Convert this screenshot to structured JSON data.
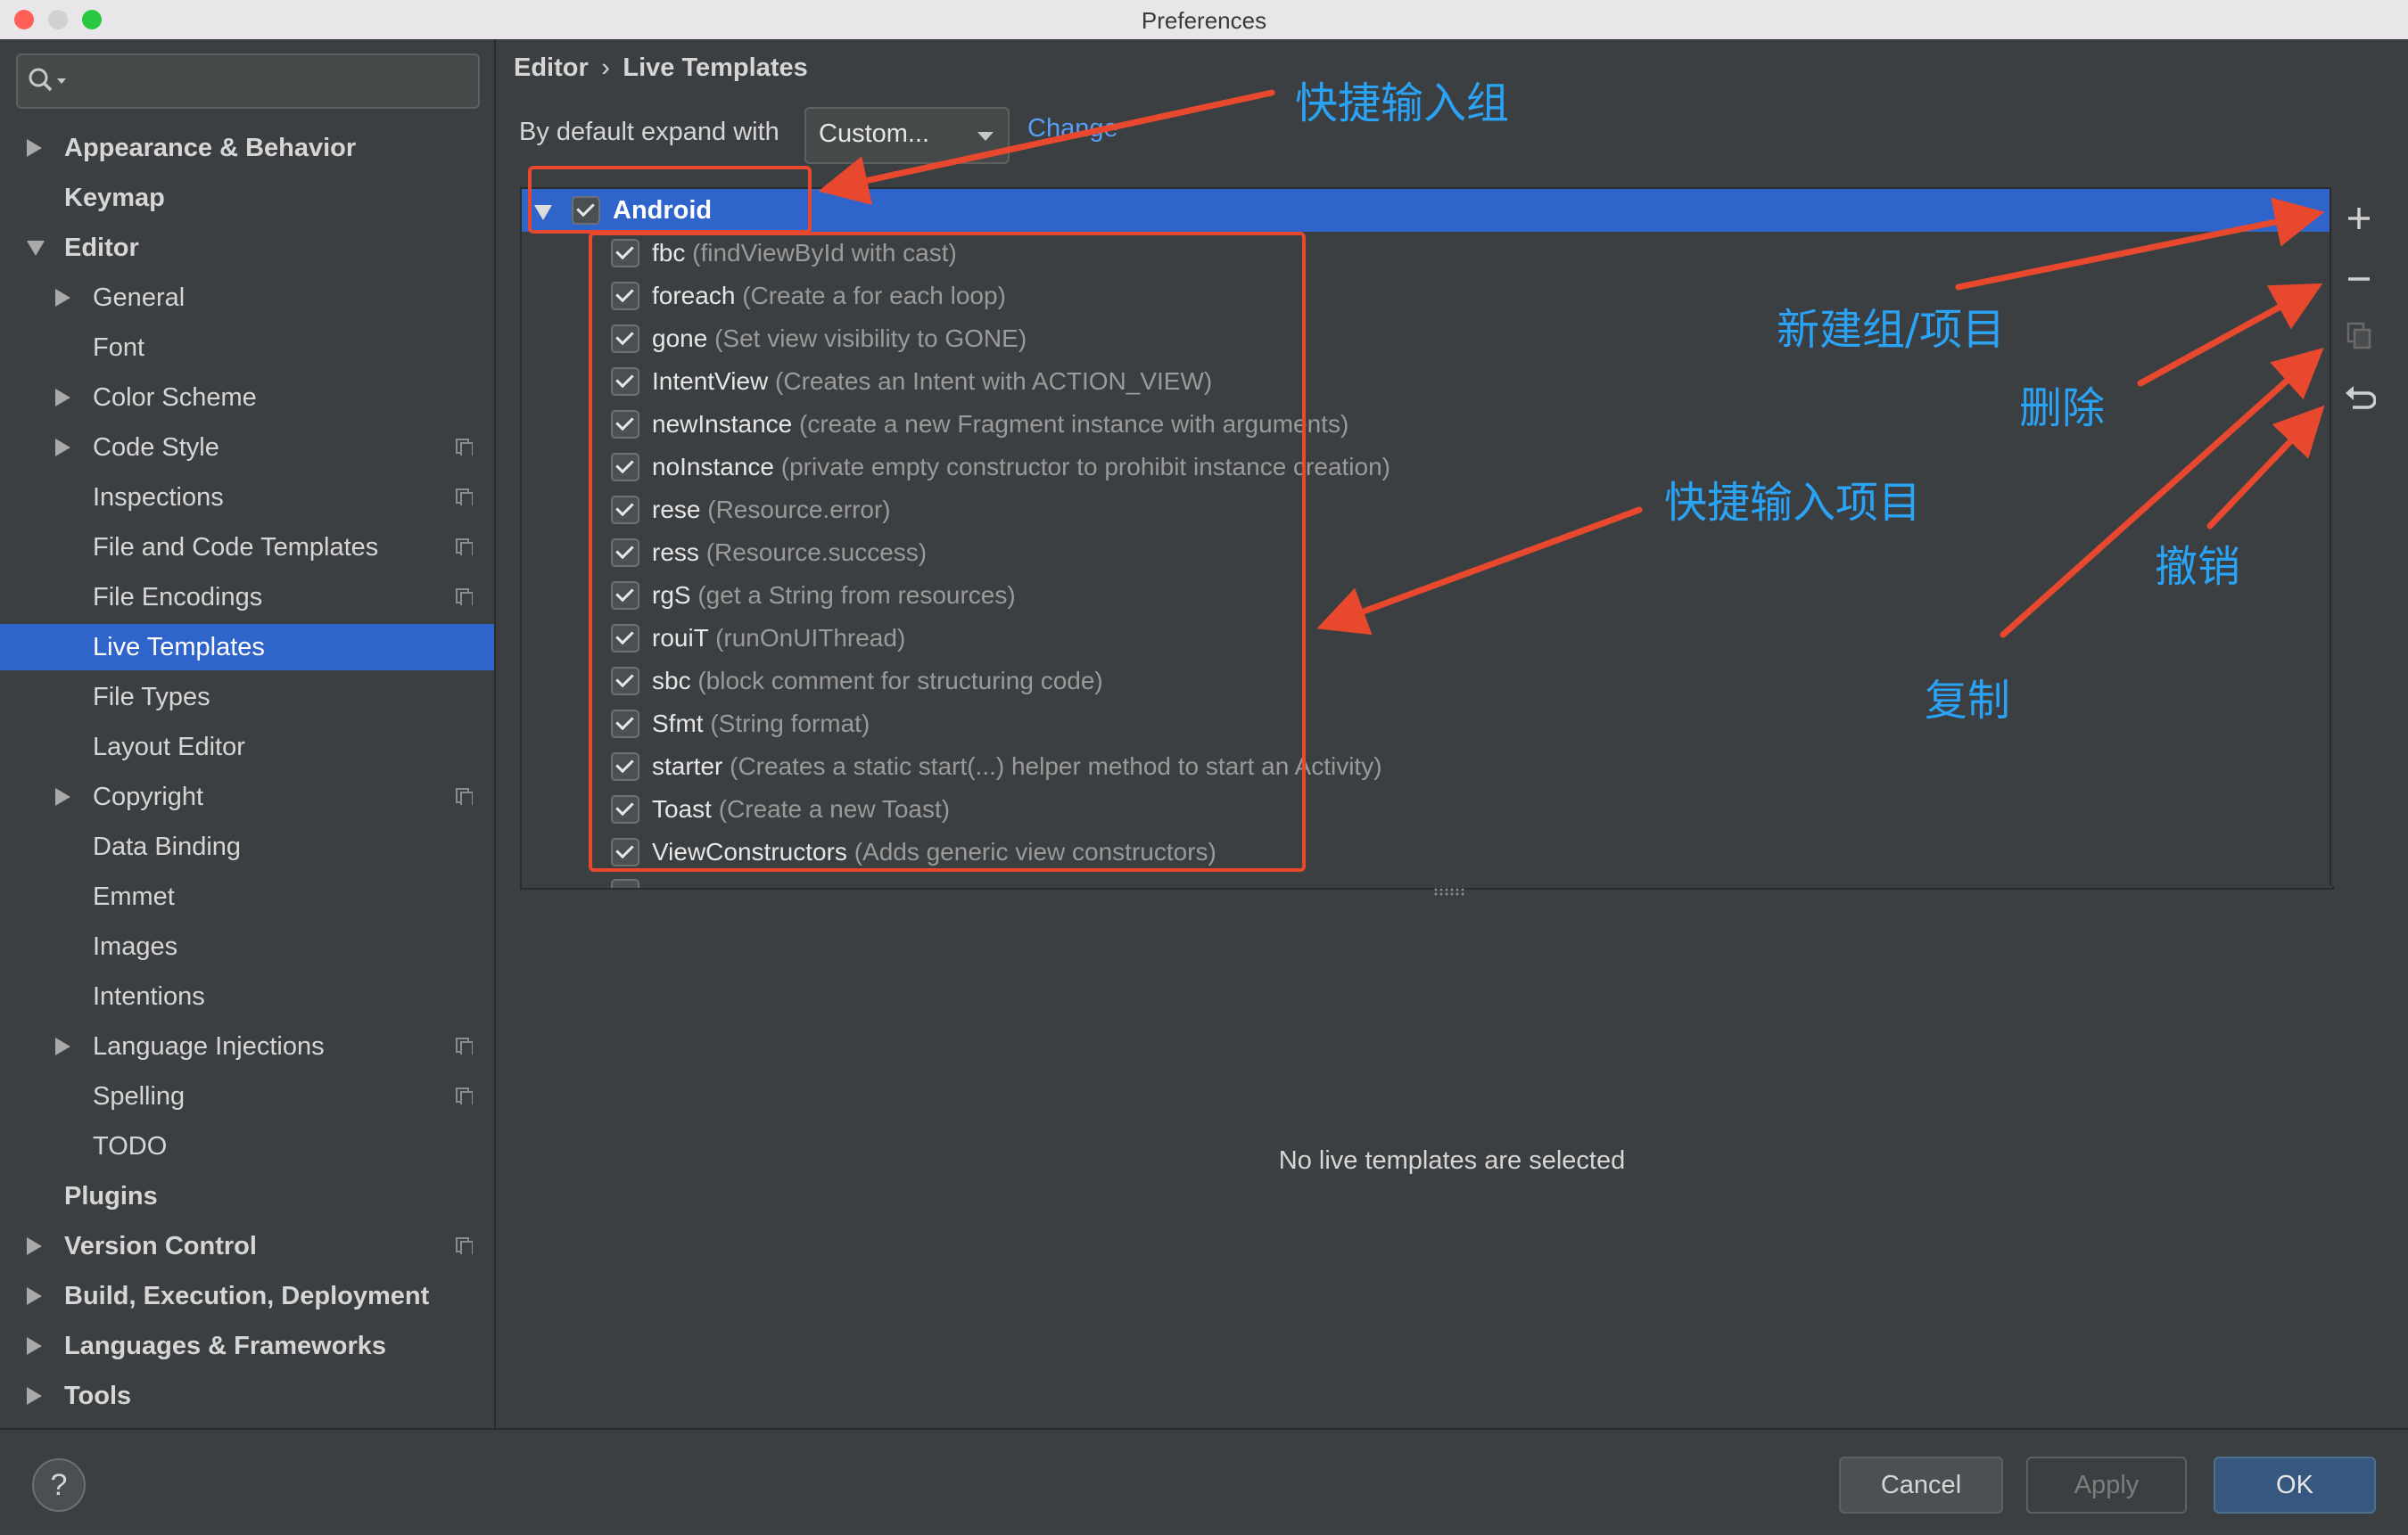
{
  "window": {
    "title": "Preferences"
  },
  "search": {
    "placeholder": ""
  },
  "tree": [
    {
      "label": "Appearance & Behavior",
      "bold": true,
      "level": 0,
      "arrow": "right",
      "icon": false
    },
    {
      "label": "Keymap",
      "bold": true,
      "level": 0,
      "arrow": "none",
      "icon": false
    },
    {
      "label": "Editor",
      "bold": true,
      "level": 0,
      "arrow": "down",
      "icon": false
    },
    {
      "label": "General",
      "bold": false,
      "level": 1,
      "arrow": "right",
      "icon": false
    },
    {
      "label": "Font",
      "bold": false,
      "level": 1,
      "arrow": "none",
      "icon": false
    },
    {
      "label": "Color Scheme",
      "bold": false,
      "level": 1,
      "arrow": "right",
      "icon": false
    },
    {
      "label": "Code Style",
      "bold": false,
      "level": 1,
      "arrow": "right",
      "icon": true
    },
    {
      "label": "Inspections",
      "bold": false,
      "level": 1,
      "arrow": "none",
      "icon": true
    },
    {
      "label": "File and Code Templates",
      "bold": false,
      "level": 1,
      "arrow": "none",
      "icon": true
    },
    {
      "label": "File Encodings",
      "bold": false,
      "level": 1,
      "arrow": "none",
      "icon": true
    },
    {
      "label": "Live Templates",
      "bold": false,
      "level": 1,
      "arrow": "none",
      "icon": false,
      "selected": true
    },
    {
      "label": "File Types",
      "bold": false,
      "level": 1,
      "arrow": "none",
      "icon": false
    },
    {
      "label": "Layout Editor",
      "bold": false,
      "level": 1,
      "arrow": "none",
      "icon": false
    },
    {
      "label": "Copyright",
      "bold": false,
      "level": 1,
      "arrow": "right",
      "icon": true
    },
    {
      "label": "Data Binding",
      "bold": false,
      "level": 1,
      "arrow": "none",
      "icon": false
    },
    {
      "label": "Emmet",
      "bold": false,
      "level": 1,
      "arrow": "none",
      "icon": false
    },
    {
      "label": "Images",
      "bold": false,
      "level": 1,
      "arrow": "none",
      "icon": false
    },
    {
      "label": "Intentions",
      "bold": false,
      "level": 1,
      "arrow": "none",
      "icon": false
    },
    {
      "label": "Language Injections",
      "bold": false,
      "level": 1,
      "arrow": "right",
      "icon": true
    },
    {
      "label": "Spelling",
      "bold": false,
      "level": 1,
      "arrow": "none",
      "icon": true
    },
    {
      "label": "TODO",
      "bold": false,
      "level": 1,
      "arrow": "none",
      "icon": false
    },
    {
      "label": "Plugins",
      "bold": true,
      "level": 0,
      "arrow": "none",
      "icon": false
    },
    {
      "label": "Version Control",
      "bold": true,
      "level": 0,
      "arrow": "right",
      "icon": true
    },
    {
      "label": "Build, Execution, Deployment",
      "bold": true,
      "level": 0,
      "arrow": "right",
      "icon": false
    },
    {
      "label": "Languages & Frameworks",
      "bold": true,
      "level": 0,
      "arrow": "right",
      "icon": false
    },
    {
      "label": "Tools",
      "bold": true,
      "level": 0,
      "arrow": "right",
      "icon": false
    }
  ],
  "breadcrumb": {
    "parent": "Editor",
    "separator": "›",
    "current": "Live Templates"
  },
  "expand": {
    "label": "By default expand with",
    "value": "Custom...",
    "link": "Change"
  },
  "group": {
    "name": "Android",
    "checked": true
  },
  "templates": [
    {
      "abbr": "fbc",
      "desc": "(findViewById with cast)"
    },
    {
      "abbr": "foreach",
      "desc": "(Create a for each loop)"
    },
    {
      "abbr": "gone",
      "desc": "(Set view visibility to GONE)"
    },
    {
      "abbr": "IntentView",
      "desc": "(Creates an Intent with ACTION_VIEW)"
    },
    {
      "abbr": "newInstance",
      "desc": "(create a new Fragment instance with arguments)"
    },
    {
      "abbr": "noInstance",
      "desc": "(private empty constructor to prohibit instance creation)"
    },
    {
      "abbr": "rese",
      "desc": "(Resource.error)"
    },
    {
      "abbr": "ress",
      "desc": "(Resource.success)"
    },
    {
      "abbr": "rgS",
      "desc": "(get a String from resources)"
    },
    {
      "abbr": "rouiT",
      "desc": "(runOnUIThread)"
    },
    {
      "abbr": "sbc",
      "desc": "(block comment for structuring code)"
    },
    {
      "abbr": "Sfmt",
      "desc": "(String format)"
    },
    {
      "abbr": "starter",
      "desc": "(Creates a static start(...) helper method to start an Activity)"
    },
    {
      "abbr": "Toast",
      "desc": "(Create a new Toast)"
    },
    {
      "abbr": "ViewConstructors",
      "desc": "(Adds generic view constructors)"
    }
  ],
  "empty_message": "No live templates are selected",
  "buttons": {
    "help": "?",
    "cancel": "Cancel",
    "apply": "Apply",
    "ok": "OK"
  },
  "annotations": {
    "group": "快捷输入组",
    "new": "新建组/项目",
    "delete": "删除",
    "items": "快捷输入项目",
    "undo": "撤销",
    "copy": "复制"
  },
  "colors": {
    "selection": "#2f65ca",
    "annotation_text": "#2aa3f5",
    "annotation_arrow": "#e8492e",
    "background": "#3c3f41"
  }
}
